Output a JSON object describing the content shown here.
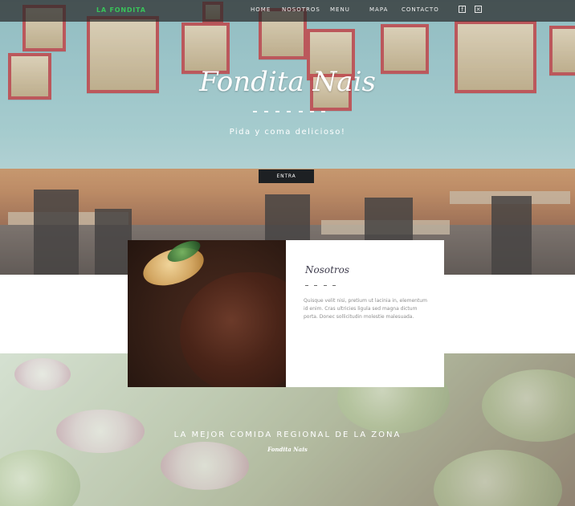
{
  "nav": {
    "brand": "LA FONDITA",
    "links": [
      "HOME",
      "NOSOTROS",
      "MENU",
      "MAPA",
      "CONTACTO"
    ],
    "social_icons": [
      "facebook-icon",
      "close-icon"
    ]
  },
  "hero": {
    "title": "Fondita Nais",
    "subtitle": "Pida y coma delicioso!",
    "button_label": "ENTRA"
  },
  "about": {
    "title": "Nosotros",
    "text": "Quisque velit nisi, pretium ut lacinia in, elementum id enim. Cras ultricies ligula sed magna dictum porta. Donec sollicitudin molestie malesuada."
  },
  "footer": {
    "tagline": "LA MEJOR COMIDA REGIONAL DE LA ZONA",
    "brand": "Fondita Nais"
  },
  "colors": {
    "brand_green": "#39c35a",
    "button_dark": "#1d2023",
    "frame_red": "#b2262b"
  }
}
